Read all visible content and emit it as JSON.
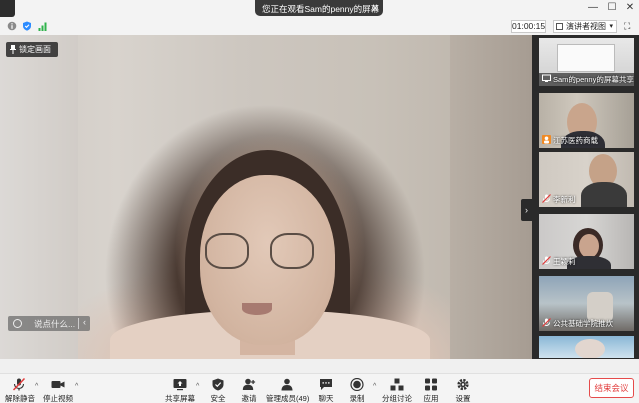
{
  "window": {
    "title": "您正在观看Sam的penny的屏幕",
    "close_label": "✕",
    "minimize": "—",
    "maximize": "☐",
    "close": "✕"
  },
  "topbar": {
    "timer": "01:00:15",
    "view_label": "演讲者视图",
    "view_caret": "▾",
    "fullscreen": "⛶"
  },
  "main": {
    "lock_label": "锁定画面",
    "chat_placeholder": "说点什么...",
    "chat_arrow": "‹",
    "collapse_arrow": "›"
  },
  "participants": [
    {
      "name": "Sam的penny的屏幕共享"
    },
    {
      "name": "江苏医药商载"
    },
    {
      "name": "李新利"
    },
    {
      "name": "王颖莉"
    },
    {
      "name": "公共基础学院推炊"
    },
    {
      "name": ""
    }
  ],
  "toolbar": {
    "unmute": "解除静音",
    "stop_video": "停止视频",
    "share": "共享屏幕",
    "security": "安全",
    "invite": "邀请",
    "members": "管理成员(49)",
    "chat": "聊天",
    "record": "录制",
    "breakout": "分组讨论",
    "apps": "应用",
    "settings": "设置",
    "end": "结束会议",
    "caret": "^"
  },
  "colors": {
    "accent": "#2d8cff",
    "end_red": "#e23c3c",
    "mic_muted": "#e23c3c",
    "signal_green": "#2fb34b"
  }
}
